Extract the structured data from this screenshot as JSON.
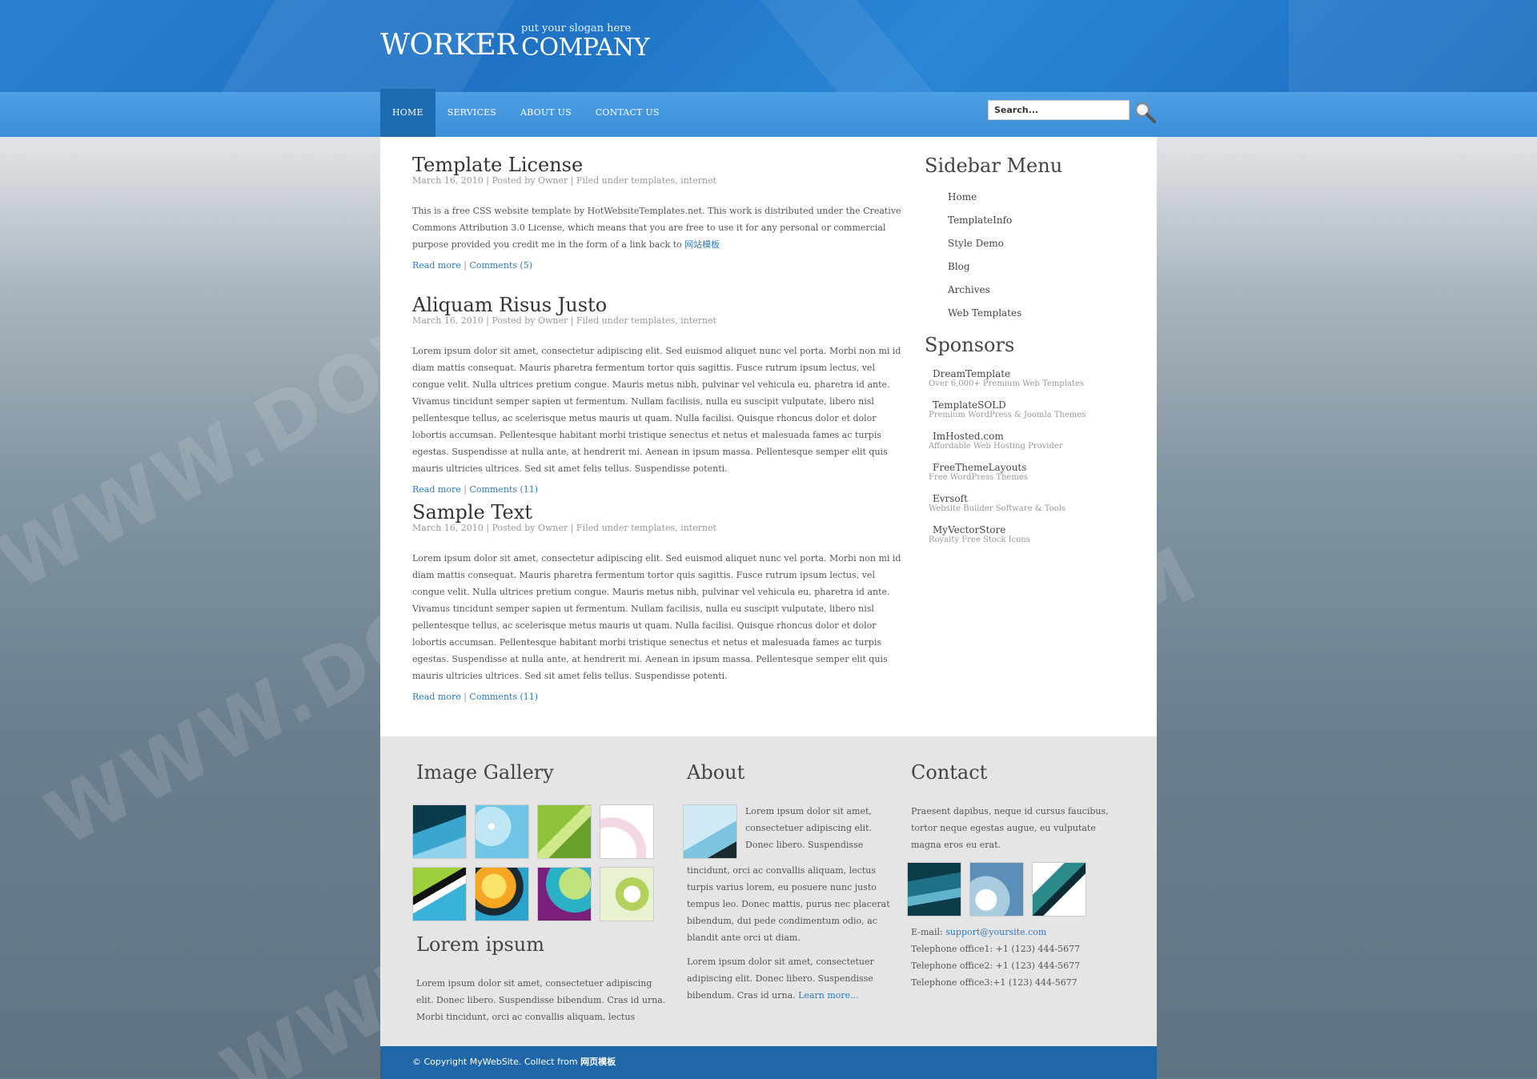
{
  "header": {
    "logo_word1": "WORKER",
    "logo_word2": "COMPANY",
    "slogan": "put your slogan here"
  },
  "nav": {
    "items": [
      {
        "label": "HOME",
        "active": true
      },
      {
        "label": "SERVICES"
      },
      {
        "label": "ABOUT US"
      },
      {
        "label": "CONTACT US"
      }
    ]
  },
  "search": {
    "value": "Search..."
  },
  "posts": [
    {
      "title": "Template License",
      "meta": "March 16, 2010 | Posted by Owner | Filed under templates, internet",
      "body": "This is a free CSS website template by HotWebsiteTemplates.net. This work is distributed under the Creative Commons Attribution 3.0 License, which means that you are free to use it for any personal or commercial purpose provided you credit me in the form of a link back to ",
      "body_link": "网站模板",
      "read_more": "Read more",
      "sep": " | ",
      "comments": "Comments (5)"
    },
    {
      "title": "Aliquam Risus Justo",
      "meta": "March 16, 2010 | Posted by Owner | Filed under templates, internet",
      "body": "Lorem ipsum dolor sit amet, consectetur adipiscing elit. Sed euismod aliquet nunc vel porta. Morbi non mi id diam mattis consequat. Mauris pharetra fermentum tortor quis sagittis. Fusce rutrum ipsum lectus, vel congue velit. Nulla ultrices pretium congue. Mauris metus nibh, pulvinar vel vehicula eu, pharetra id ante. Vivamus tincidunt semper sapien ut fermentum. Nullam facilisis, nulla eu suscipit vulputate, libero nisl pellentesque tellus, ac scelerisque metus mauris ut quam. Nulla facilisi. Quisque rhoncus dolor et dolor lobortis accumsan. Pellentesque habitant morbi tristique senectus et netus et malesuada fames ac turpis egestas. Suspendisse at nulla ante, at hendrerit mi. Aenean in ipsum massa. Pellentesque semper elit quis mauris ultricies ultrices. Sed sit amet felis tellus. Suspendisse potenti.",
      "read_more": "Read more",
      "sep": " | ",
      "comments": "Comments (11)"
    },
    {
      "title": "Sample Text",
      "meta": "March 16, 2010 | Posted by Owner | Filed under templates, internet",
      "body": "Lorem ipsum dolor sit amet, consectetur adipiscing elit. Sed euismod aliquet nunc vel porta. Morbi non mi id diam mattis consequat. Mauris pharetra fermentum tortor quis sagittis. Fusce rutrum ipsum lectus, vel congue velit. Nulla ultrices pretium congue. Mauris metus nibh, pulvinar vel vehicula eu, pharetra id ante. Vivamus tincidunt semper sapien ut fermentum. Nullam facilisis, nulla eu suscipit vulputate, libero nisl pellentesque tellus, ac scelerisque metus mauris ut quam. Nulla facilisi. Quisque rhoncus dolor et dolor lobortis accumsan. Pellentesque habitant morbi tristique senectus et netus et malesuada fames ac turpis egestas. Suspendisse at nulla ante, at hendrerit mi. Aenean in ipsum massa. Pellentesque semper elit quis mauris ultricies ultrices. Sed sit amet felis tellus. Suspendisse potenti.",
      "read_more": "Read more",
      "sep": " | ",
      "comments": "Comments (11)"
    }
  ],
  "sidebar": {
    "menu_title": "Sidebar Menu",
    "menu": [
      "Home",
      "TemplateInfo",
      "Style Demo",
      "Blog",
      "Archives",
      "Web Templates"
    ],
    "sponsors_title": "Sponsors",
    "sponsors": [
      {
        "name": "DreamTemplate",
        "desc": "Over 6,000+ Premium Web Templates"
      },
      {
        "name": "TemplateSOLD",
        "desc": "Premium WordPress & Joomla Themes"
      },
      {
        "name": "ImHosted.com",
        "desc": "Affordable Web Hosting Provider"
      },
      {
        "name": "FreeThemeLayouts",
        "desc": "Free WordPress Themes"
      },
      {
        "name": "Evrsoft",
        "desc": "Website Builder Software & Tools"
      },
      {
        "name": "MyVectorStore",
        "desc": "Royalty Free Stock Icons"
      }
    ]
  },
  "footer": {
    "gallery_title": "Image Gallery",
    "lorem_title": "Lorem ipsum",
    "lorem_text": "Lorem ipsum dolor sit amet, consectetuer adipiscing elit. Donec libero. Suspendisse bibendum. Cras id urna. Morbi tincidunt, orci ac convallis aliquam, lectus",
    "about_title": "About",
    "about_text1": "Lorem ipsum dolor sit amet, consectetuer adipiscing elit. Donec libero. Suspendisse",
    "about_text2": "tincidunt, orci ac convallis aliquam, lectus turpis varius lorem, eu posuere nunc justo tempus leo. Donec mattis, purus nec placerat bibendum, dui pede condimentum odio, ac blandit ante orci ut diam.",
    "about_text3": "Lorem ipsum dolor sit amet, consectetuer adipiscing elit. Donec libero. Suspendisse bibendum. Cras id urna. ",
    "about_link": "Learn more...",
    "contact_title": "Contact",
    "contact_text": "Praesent dapibus, neque id cursus faucibus, tortor neque egestas augue, eu vulputate magna eros eu erat.",
    "email_label": "E-mail: ",
    "email": "support@yoursite.com",
    "tel1": "Telephone office1: +1 (123) 444-5677",
    "tel2": "Telephone office2: +1 (123) 444-5677",
    "tel3": "Telephone office3:+1 (123) 444-5677",
    "copyright": "© Copyright MyWebSite. Collect from ",
    "copyright_link": "网页模板"
  },
  "colors": {
    "header_blue": "#2a7fcf",
    "nav_blue": "#4da0e4",
    "active_tab": "#1e6aae",
    "link": "#2a7ac0",
    "copy_bar": "#1f67a8"
  }
}
